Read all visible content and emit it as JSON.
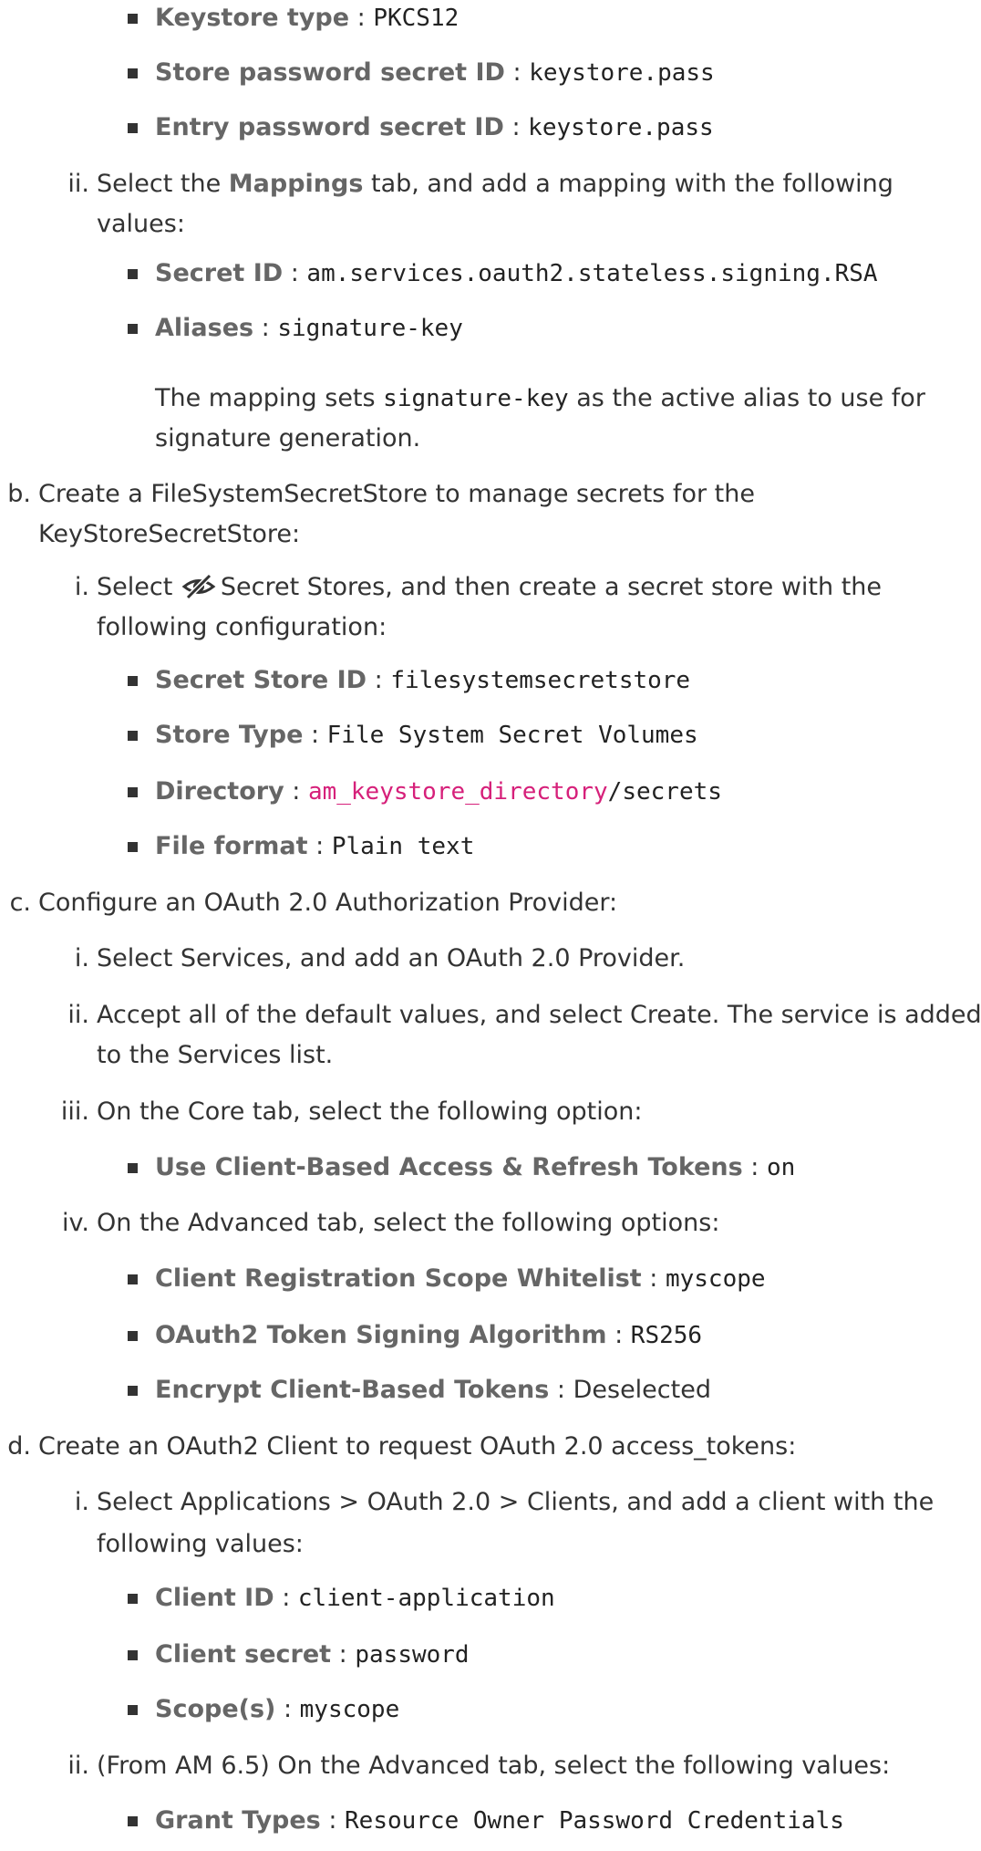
{
  "text": {
    "sep": ":",
    "sep_sp": " : ",
    "keystore": {
      "type_label": "Keystore type",
      "type_value": "PKCS12",
      "store_pw_label": "Store password secret ID",
      "store_pw_value": "keystore.pass",
      "entry_pw_label": "Entry password secret ID",
      "entry_pw_value": "keystore.pass"
    },
    "step_a_ii": {
      "marker": "ii.",
      "pre": "Select the ",
      "bold": "Mappings",
      "post": " tab, and add a mapping with the following",
      "line2": "values:",
      "secret_id_label": "Secret ID",
      "secret_id_value": "am.services.oauth2.stateless.signing.RSA",
      "aliases_label": "Aliases",
      "aliases_value": "signature-key",
      "note_pre": "The mapping sets ",
      "note_code": "signature-key",
      "note_post": " as the active alias to use for",
      "note_line2": "signature generation."
    },
    "step_b": {
      "marker": "b.",
      "line1": "Create a FileSystemSecretStore to manage secrets for the",
      "line2": "KeyStoreSecretStore:",
      "i_marker": "i.",
      "i_pre": "Select ",
      "i_post": "Secret Stores, and then create a secret store with the",
      "i_line2": "following configuration:",
      "store_id_label": "Secret Store ID",
      "store_id_value": "filesystemsecretstore",
      "store_type_label": "Store Type",
      "store_type_value": "File System Secret Volumes",
      "directory_label": "Directory",
      "directory_var": "am_keystore_directory",
      "directory_suffix": "/secrets",
      "file_format_label": "File format",
      "file_format_value": "Plain text"
    },
    "step_c": {
      "marker": "c.",
      "line1": "Configure an OAuth 2.0 Authorization Provider:",
      "i_marker": "i.",
      "i_text": "Select Services, and add an OAuth 2.0 Provider.",
      "ii_marker": "ii.",
      "ii_line1": "Accept all of the default values, and select Create. The service is added",
      "ii_line2": "to the Services list.",
      "iii_marker": "iii.",
      "iii_text": "On the Core tab, select the following option:",
      "client_tokens_label": "Use Client-Based Access & Refresh Tokens",
      "client_tokens_value": "on",
      "iv_marker": "iv.",
      "iv_text": "On the Advanced tab, select the following options:",
      "scope_wl_label": "Client Registration Scope Whitelist",
      "scope_wl_value": "myscope",
      "signing_alg_label": "OAuth2 Token Signing Algorithm",
      "signing_alg_value": "RS256",
      "encrypt_label": "Encrypt Client-Based Tokens",
      "encrypt_value": "Deselected"
    },
    "step_d": {
      "marker": "d.",
      "line1": "Create an OAuth2 Client to request OAuth 2.0 access_tokens:",
      "i_marker": "i.",
      "i_line1": "Select Applications > OAuth 2.0 > Clients, and add a client with the",
      "i_line2": "following values:",
      "client_id_label": "Client ID",
      "client_id_value": "client-application",
      "client_secret_label": "Client secret",
      "client_secret_value": "password",
      "scopes_label": "Scope(s)",
      "scopes_value": "myscope",
      "ii_marker": "ii.",
      "ii_text": "(From AM 6.5) On the Advanced tab, select the following values:",
      "grant_types_label": "Grant Types",
      "grant_types_value": "Resource Owner Password Credentials"
    }
  },
  "colors": {
    "text": "#333333",
    "label": "#666666",
    "code": "#222222",
    "variable": "#d6207a"
  },
  "icons": {
    "secret_stores": "eye-slash-icon"
  }
}
